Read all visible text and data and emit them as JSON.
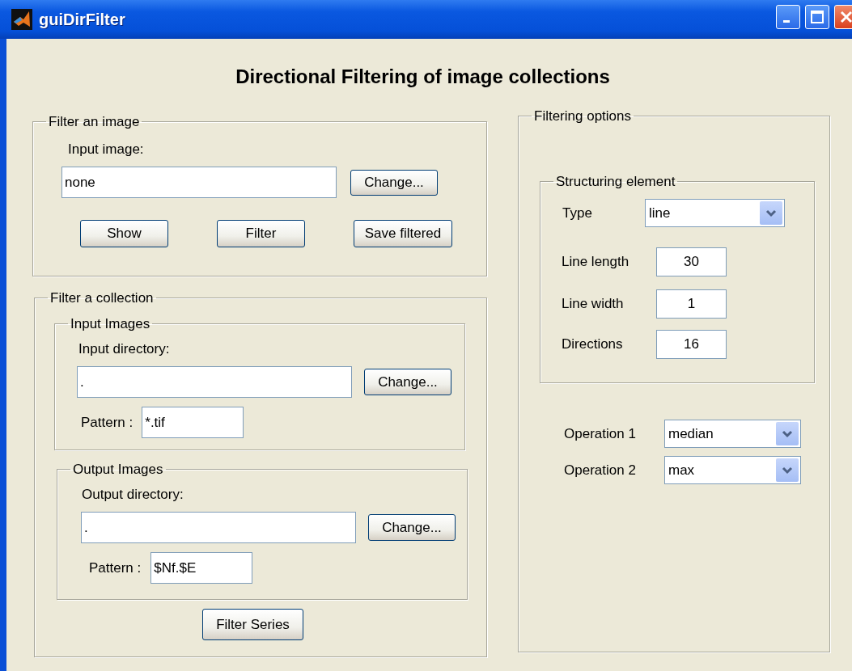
{
  "window": {
    "title": "guiDirFilter"
  },
  "heading": "Directional Filtering of image collections",
  "filter_image": {
    "title": "Filter an image",
    "input_label": "Input image:",
    "input_value": "none",
    "change_button": "Change...",
    "buttons": [
      "Show",
      "Filter",
      "Save filtered"
    ]
  },
  "filter_collection": {
    "title": "Filter a collection",
    "input_images": {
      "title": "Input Images",
      "directory_label": "Input directory:",
      "directory_value": ".",
      "change_button": "Change...",
      "pattern_label": "Pattern :",
      "pattern_value": "*.tif"
    },
    "output_images": {
      "title": "Output Images",
      "directory_label": "Output directory:",
      "directory_value": ".",
      "change_button": "Change...",
      "pattern_label": "Pattern :",
      "pattern_value": "$Nf.$E"
    },
    "run_button": "Filter Series"
  },
  "filtering_options": {
    "title": "Filtering options",
    "structuring_element": {
      "title": "Structuring element",
      "type_label": "Type",
      "type_value": "line",
      "fields": [
        {
          "label": "Line length",
          "value": "30"
        },
        {
          "label": "Line width",
          "value": "1"
        },
        {
          "label": "Directions",
          "value": "16"
        }
      ]
    },
    "operations": [
      {
        "label": "Operation 1",
        "value": "median"
      },
      {
        "label": "Operation 2",
        "value": "max"
      }
    ]
  }
}
